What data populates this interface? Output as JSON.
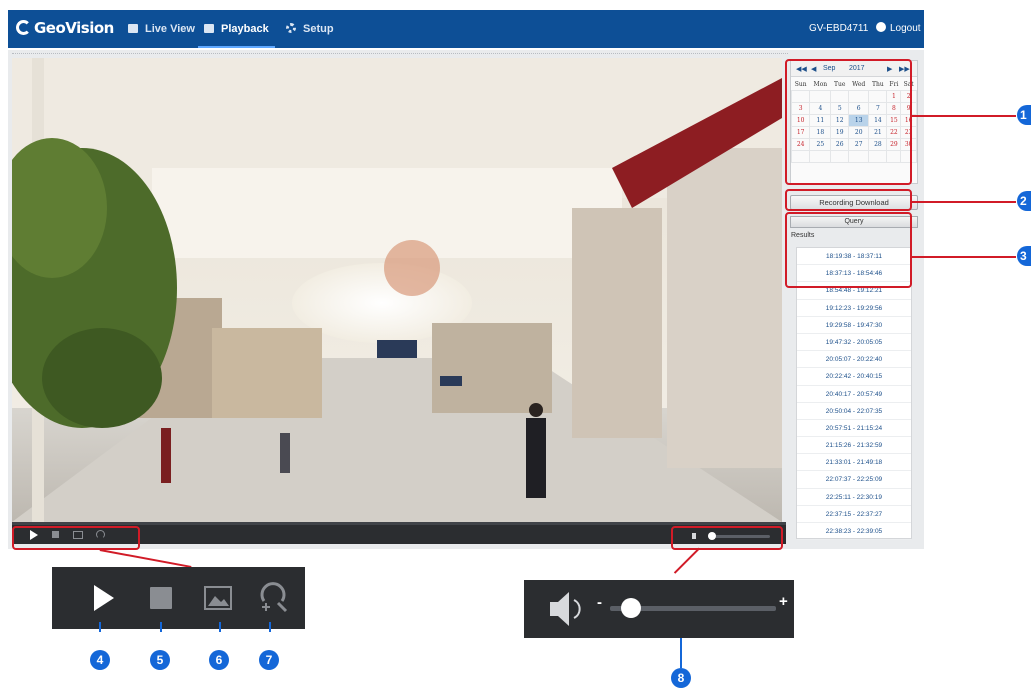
{
  "nav": {
    "logo_text": "GeoVision",
    "tabs": [
      {
        "label": "Live View"
      },
      {
        "label": "Playback",
        "active": true
      },
      {
        "label": "Setup"
      }
    ],
    "device_name": "GV-EBD4711",
    "logout_label": "Logout"
  },
  "calendar": {
    "month": "Sep",
    "year": "2017",
    "weekdays": [
      "Sun",
      "Mon",
      "Tue",
      "Wed",
      "Thu",
      "Fri",
      "Sat"
    ],
    "weeks": [
      [
        "",
        "",
        "",
        "",
        "",
        "1",
        "2"
      ],
      [
        "3",
        "4",
        "5",
        "6",
        "7",
        "8",
        "9"
      ],
      [
        "10",
        "11",
        "12",
        "13",
        "14",
        "15",
        "16"
      ],
      [
        "17",
        "18",
        "19",
        "20",
        "21",
        "22",
        "23"
      ],
      [
        "24",
        "25",
        "26",
        "27",
        "28",
        "29",
        "30"
      ],
      [
        "",
        "",
        "",
        "",
        "",
        "",
        ""
      ]
    ],
    "selected_day": "13"
  },
  "recording_download_label": "Recording Download",
  "query_label": "Query",
  "results_label": "Results",
  "results": [
    "18:19:38 - 18:37:11",
    "18:37:13 - 18:54:46",
    "18:54:48 - 19:12:21",
    "19:12:23 - 19:29:56",
    "19:29:58 - 19:47:30",
    "19:47:32 - 20:05:05",
    "20:05:07 - 20:22:40",
    "20:22:42 - 20:40:15",
    "20:40:17 - 20:57:49",
    "20:50:04 - 22:07:35",
    "20:57:51 - 21:15:24",
    "21:15:26 - 21:32:59",
    "21:33:01 - 21:49:18",
    "22:07:37 - 22:25:09",
    "22:25:11 - 22:30:19",
    "22:37:15 - 22:37:27",
    "22:38:23 - 22:39:05"
  ],
  "callouts": [
    "1",
    "2",
    "3",
    "4",
    "5",
    "6",
    "7",
    "8"
  ],
  "volume": {
    "minus": "-",
    "plus": "+",
    "level": 0.1
  },
  "colors": {
    "nav_bg": "#0d4f96",
    "annotation_red": "#d11b27",
    "callout_blue": "#1467d8",
    "control_bar": "#2b2d30"
  },
  "icons": {
    "play": "play-icon",
    "stop": "stop-icon",
    "snapshot": "snapshot-icon",
    "zoom": "digital-zoom-icon",
    "volume": "speaker-icon"
  }
}
